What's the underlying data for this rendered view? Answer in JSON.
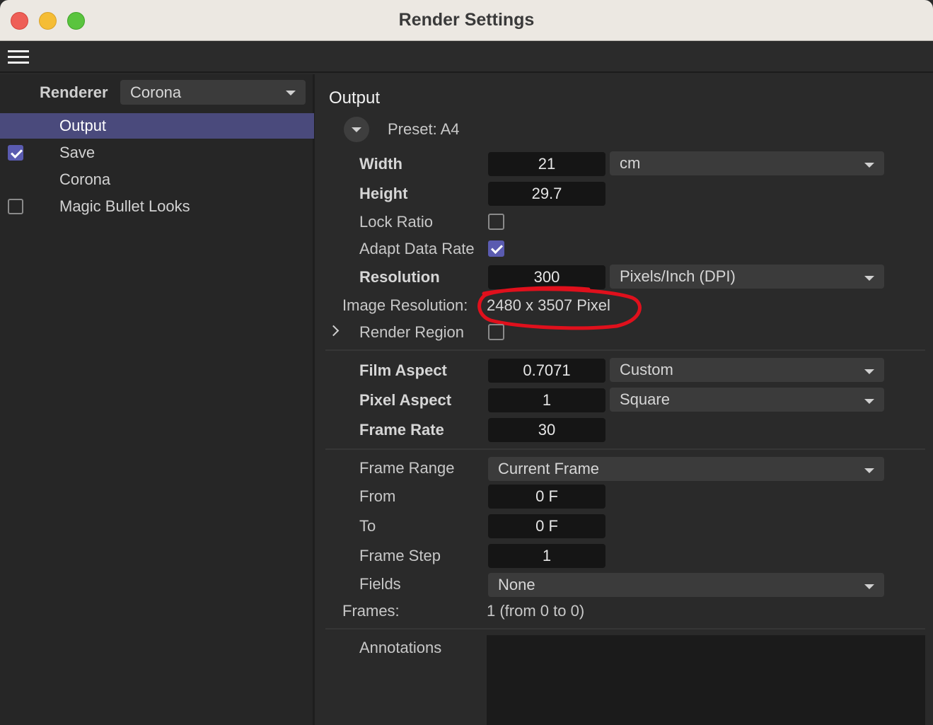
{
  "window": {
    "title": "Render Settings"
  },
  "left_panel": {
    "renderer_label": "Renderer",
    "renderer_value": "Corona",
    "items": [
      {
        "label": "Output",
        "selected": true,
        "checkbox": null
      },
      {
        "label": "Save",
        "selected": false,
        "checkbox": true
      },
      {
        "label": "Corona",
        "selected": false,
        "checkbox": null
      },
      {
        "label": "Magic Bullet Looks",
        "selected": false,
        "checkbox": false
      }
    ]
  },
  "output": {
    "title": "Output",
    "preset": "Preset: A4",
    "width": {
      "label": "Width",
      "value": "21",
      "unit": "cm"
    },
    "height": {
      "label": "Height",
      "value": "29.7"
    },
    "lock_ratio": {
      "label": "Lock Ratio",
      "checked": false
    },
    "adapt_data_rate": {
      "label": "Adapt Data Rate",
      "checked": true
    },
    "resolution": {
      "label": "Resolution",
      "value": "300",
      "unit": "Pixels/Inch (DPI)"
    },
    "image_resolution": {
      "label": "Image Resolution:",
      "value": "2480 x 3507 Pixel"
    },
    "render_region": {
      "label": "Render Region",
      "checked": false
    },
    "film_aspect": {
      "label": "Film Aspect",
      "value": "0.7071",
      "preset": "Custom"
    },
    "pixel_aspect": {
      "label": "Pixel Aspect",
      "value": "1",
      "preset": "Square"
    },
    "frame_rate": {
      "label": "Frame Rate",
      "value": "30"
    },
    "frame_range": {
      "label": "Frame Range",
      "value": "Current Frame"
    },
    "from": {
      "label": "From",
      "value": "0 F"
    },
    "to": {
      "label": "To",
      "value": "0 F"
    },
    "frame_step": {
      "label": "Frame Step",
      "value": "1"
    },
    "fields": {
      "label": "Fields",
      "value": "None"
    },
    "frames": {
      "label": "Frames:",
      "value": "1 (from 0 to 0)"
    },
    "annotations": {
      "label": "Annotations"
    }
  },
  "colors": {
    "accent": "#5a5bb0",
    "selected_row": "#4a4a7c",
    "annotation_mark": "#e0101c"
  }
}
